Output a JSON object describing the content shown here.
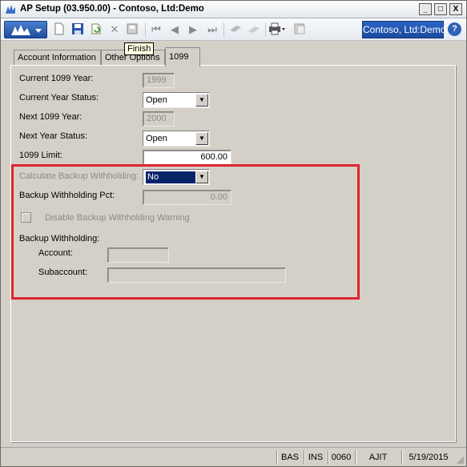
{
  "window": {
    "title": "AP Setup (03.950.00) - Contoso, Ltd:Demo",
    "controls": {
      "minimize": "_",
      "maximize": "□",
      "close": "X"
    }
  },
  "toolbar": {
    "tooltip": "Finish",
    "company": "Contoso, Ltd:Demo",
    "help": "?",
    "icons": [
      "logo-menu-icon",
      "new-icon",
      "save-icon",
      "refresh-icon",
      "delete-icon",
      "finish-icon",
      "first-icon",
      "previous-icon",
      "next-icon",
      "last-icon",
      "copy-icon",
      "paste-icon",
      "print-icon",
      "notes-icon"
    ]
  },
  "tabs": [
    {
      "label": "Account Information",
      "selected": false
    },
    {
      "label": "Other Options",
      "selected": false
    },
    {
      "label": "1099",
      "selected": true
    }
  ],
  "form": {
    "current_1099_year": {
      "label": "Current 1099 Year:",
      "value": "1999"
    },
    "current_year_status": {
      "label": "Current Year Status:",
      "value": "Open"
    },
    "next_1099_year": {
      "label": "Next 1099 Year:",
      "value": "2000"
    },
    "next_year_status": {
      "label": "Next Year Status:",
      "value": "Open"
    },
    "limit_1099": {
      "label": "1099 Limit:",
      "value": "600.00"
    },
    "calc_backup": {
      "label": "Calculate Backup Withholding:",
      "value": "No"
    },
    "backup_pct": {
      "label": "Backup Withholding Pct:",
      "value": "0.00"
    },
    "disable_warning": {
      "label": "Disable Backup Withholding Warning",
      "checked": false
    },
    "backup_withholding": {
      "label": "Backup Withholding:",
      "account": {
        "label": "Account:",
        "value": ""
      },
      "subaccount": {
        "label": "Subaccount:",
        "value": ""
      }
    }
  },
  "highlight_color": "#e0242c",
  "statusbar": {
    "cells": [
      "BAS",
      "INS",
      "0060",
      "AJIT",
      "5/19/2015"
    ]
  }
}
